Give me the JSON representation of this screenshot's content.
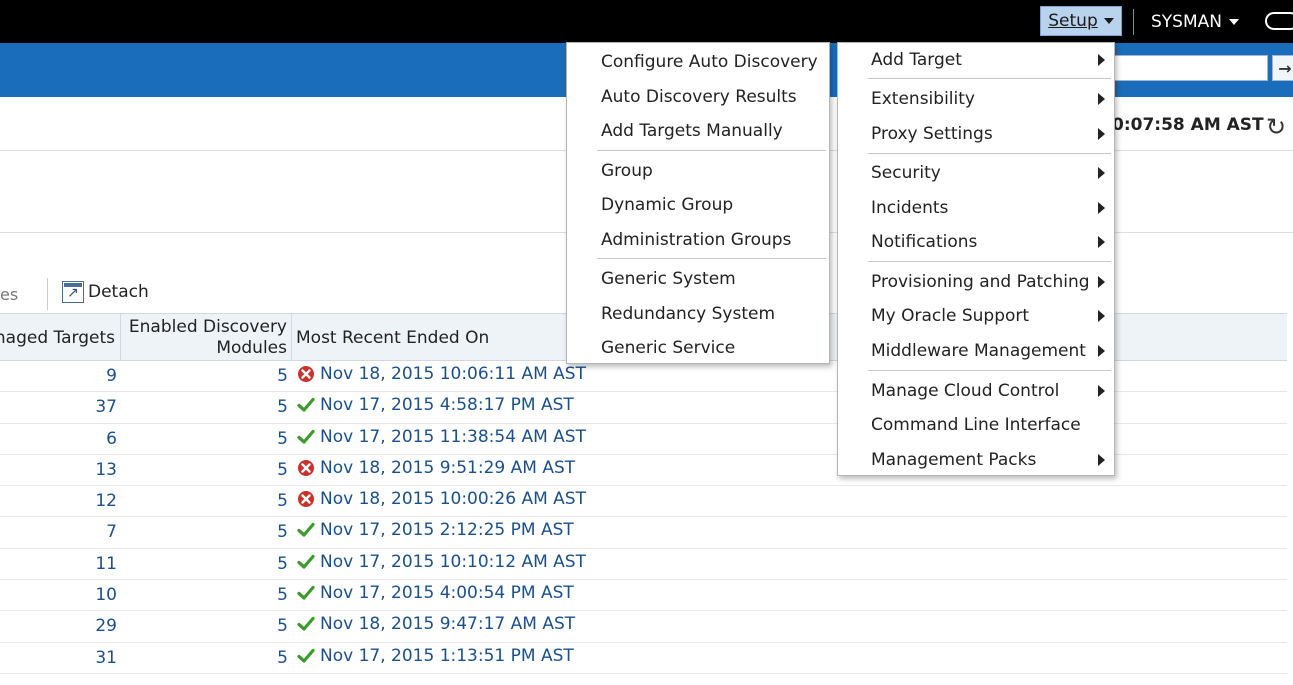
{
  "header": {
    "setup_label": "Setup",
    "user_label": "SYSMAN"
  },
  "status": {
    "time": "0:07:58 AM AST"
  },
  "toolbar": {
    "partial_label": "es",
    "detach_label": "Detach"
  },
  "table": {
    "columns": {
      "managed_targets": "naged Targets",
      "enabled_modules_line1": "Enabled Discovery",
      "enabled_modules_line2": "Modules",
      "most_recent": "Most Recent Ended On"
    },
    "rows": [
      {
        "managed": "9",
        "modules": "5",
        "status": "error",
        "ended": "Nov 18, 2015 10:06:11 AM AST"
      },
      {
        "managed": "37",
        "modules": "5",
        "status": "success",
        "ended": "Nov 17, 2015 4:58:17 PM AST"
      },
      {
        "managed": "6",
        "modules": "5",
        "status": "success",
        "ended": "Nov 17, 2015 11:38:54 AM AST"
      },
      {
        "managed": "13",
        "modules": "5",
        "status": "error",
        "ended": "Nov 18, 2015 9:51:29 AM AST"
      },
      {
        "managed": "12",
        "modules": "5",
        "status": "error",
        "ended": "Nov 18, 2015 10:00:26 AM AST"
      },
      {
        "managed": "7",
        "modules": "5",
        "status": "success",
        "ended": "Nov 17, 2015 2:12:25 PM AST"
      },
      {
        "managed": "11",
        "modules": "5",
        "status": "success",
        "ended": "Nov 17, 2015 10:10:12 AM AST"
      },
      {
        "managed": "10",
        "modules": "5",
        "status": "success",
        "ended": "Nov 17, 2015 4:00:54 PM AST"
      },
      {
        "managed": "29",
        "modules": "5",
        "status": "success",
        "ended": "Nov 18, 2015 9:47:17 AM AST"
      },
      {
        "managed": "31",
        "modules": "5",
        "status": "success",
        "ended": "Nov 17, 2015 1:13:51 PM AST"
      }
    ]
  },
  "add_target_menu": {
    "items": [
      "Configure Auto Discovery",
      "Auto Discovery Results",
      "Add Targets Manually",
      "Group",
      "Dynamic Group",
      "Administration Groups",
      "Generic System",
      "Redundancy System",
      "Generic Service"
    ]
  },
  "setup_menu": {
    "items": [
      "Add Target",
      "Extensibility",
      "Proxy Settings",
      "Security",
      "Incidents",
      "Notifications",
      "Provisioning and Patching",
      "My Oracle Support",
      "Middleware Management",
      "Manage Cloud Control",
      "Command Line Interface",
      "Management Packs"
    ]
  },
  "colors": {
    "top_bar": "#000000",
    "blue_band": "#1a6dba",
    "link": "#1b4f8a",
    "success": "#3c9a2c",
    "error": "#c8322a"
  },
  "icons": {
    "success": "check-icon",
    "error": "error-x-icon",
    "refresh": "refresh-icon",
    "detach": "detach-icon"
  }
}
